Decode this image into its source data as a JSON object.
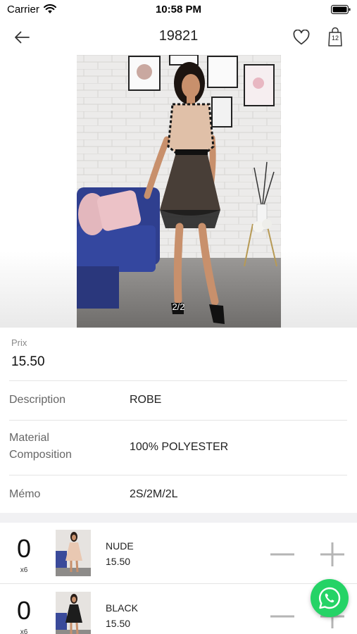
{
  "status_bar": {
    "carrier": "Carrier",
    "time": "10:58 PM"
  },
  "nav": {
    "title": "19821",
    "cart_count": "12"
  },
  "gallery": {
    "counter": "2/2"
  },
  "product": {
    "price_label": "Prix",
    "price": "15.50",
    "rows": [
      {
        "label": "Description",
        "value": "ROBE"
      },
      {
        "label": "Material Composition",
        "value": "100% POLYESTER"
      },
      {
        "label": "Mémo",
        "value": "2S/2M/2L"
      }
    ]
  },
  "variants": [
    {
      "qty": "0",
      "unit": "x6",
      "color": "NUDE",
      "price": "15.50"
    },
    {
      "qty": "0",
      "unit": "x6",
      "color": "BLACK",
      "price": "15.50"
    }
  ],
  "colors": {
    "whatsapp": "#25D366",
    "divider": "#e4e4e4",
    "control_gray": "#b5b5b5"
  },
  "icons": {
    "back": "arrow-left-icon",
    "favorite": "heart-icon",
    "cart": "shopping-bag-icon",
    "whatsapp": "whatsapp-icon"
  }
}
